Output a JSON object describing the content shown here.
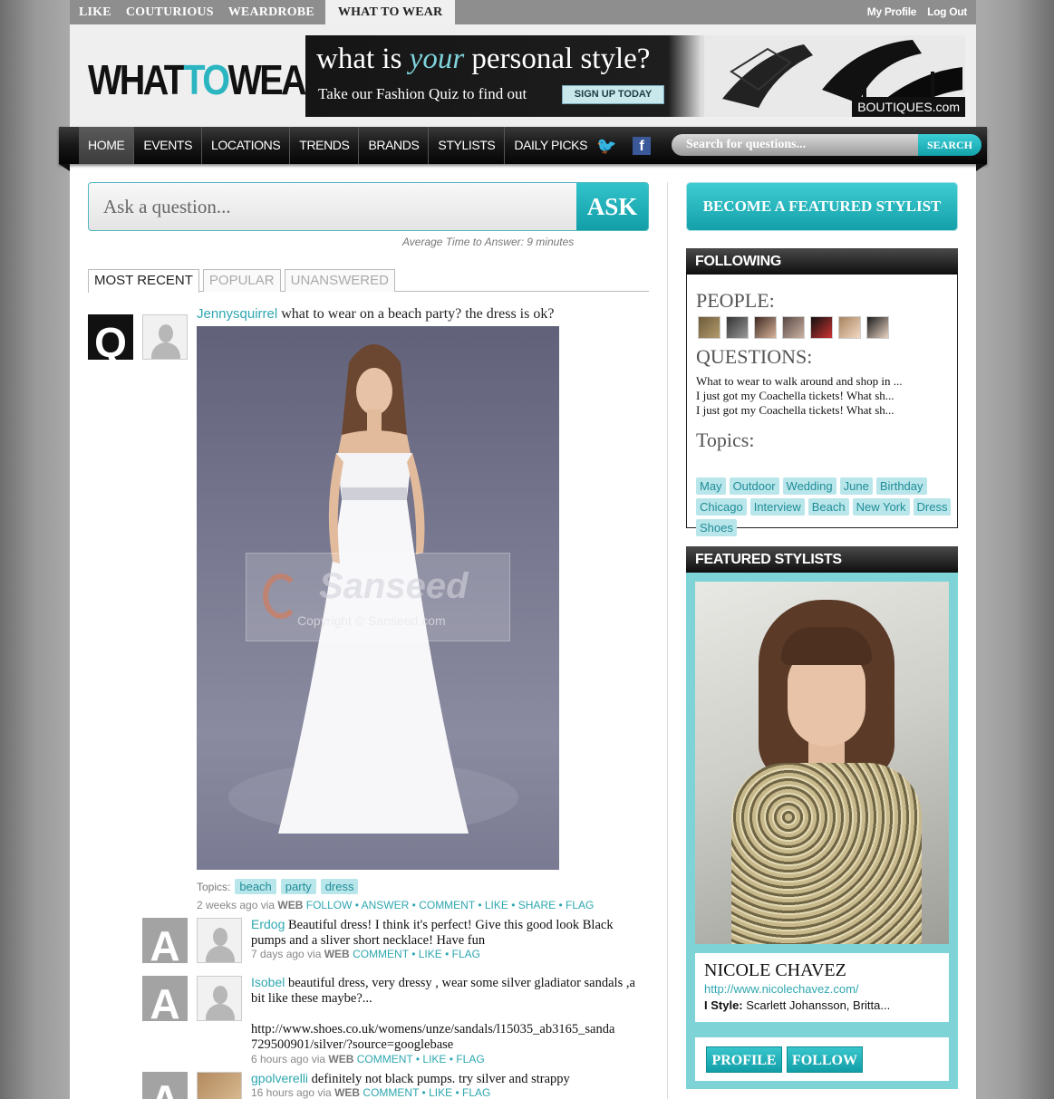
{
  "netbar": {
    "sites": [
      "LIKE",
      "COUTURIOUS",
      "WEARDROBE"
    ],
    "active_site": "WHAT TO WEAR",
    "my_profile": "My Profile",
    "log_out": "Log Out"
  },
  "logo": {
    "part1": "WHAT",
    "part2": "TO",
    "part3": "WEAR"
  },
  "banner": {
    "headline_pre": "what is ",
    "headline_em": "your",
    "headline_post": " personal style?",
    "sub": "Take our Fashion Quiz to find out",
    "cta": "SIGN UP TODAY",
    "brand": "BOUTIQUES.com"
  },
  "nav": {
    "items": [
      "HOME",
      "EVENTS",
      "LOCATIONS",
      "TRENDS",
      "BRANDS",
      "STYLISTS",
      "DAILY PICKS"
    ],
    "search_placeholder": "Search for questions...",
    "search_button": "SEARCH",
    "facebook_glyph": "f",
    "twitter_glyph": "🐦"
  },
  "ask": {
    "placeholder": "Ask a question...",
    "button": "ASK",
    "avg_time": "Average Time to Answer: 9 minutes"
  },
  "tabs": [
    "MOST RECENT",
    "POPULAR",
    "UNANSWERED"
  ],
  "question": {
    "icon_letter": "Q",
    "user": "Jennysquirrel",
    "text": " what to wear on a beach party? the dress is ok?",
    "watermark_brand": "Sanseed",
    "watermark_copy": "Copyright © Sanseed.com",
    "topics_label": "Topics:",
    "topics": [
      "beach",
      "party",
      "dress"
    ],
    "meta": {
      "time": "2 weeks ago via ",
      "source": "WEB",
      "actions": [
        "FOLLOW",
        "ANSWER",
        "COMMENT",
        "LIKE",
        "SHARE",
        "FLAG"
      ]
    }
  },
  "answers": [
    {
      "icon_letter": "A",
      "user": "Erdog",
      "text": " Beautiful dress! I think it's perfect! Give this good look Black pumps and a sliver short necklace! Have fun",
      "time": "7 days ago via ",
      "source": "WEB",
      "actions": [
        "COMMENT",
        "LIKE",
        "FLAG"
      ]
    },
    {
      "icon_letter": "A",
      "user": "Isobel",
      "text": " beautiful dress, very dressy , wear some silver gladiator sandals ,a bit like these maybe?...",
      "link_line1": "http://www.shoes.co.uk/womens/unze/sandals/l15035_ab3165_sanda",
      "link_line2": "729500901/silver/?source=googlebase",
      "time": "6 hours ago via ",
      "source": "WEB",
      "actions": [
        "COMMENT",
        "LIKE",
        "FLAG"
      ]
    },
    {
      "icon_letter": "A",
      "user": "gpolverelli",
      "text": " definitely not black pumps. try silver and strappy",
      "time": "16 hours ago via ",
      "source": "WEB",
      "actions": [
        "COMMENT",
        "LIKE",
        "FLAG"
      ]
    }
  ],
  "sidebar": {
    "become_button": "BECOME A FEATURED STYLIST",
    "following": {
      "title": "FOLLOWING",
      "people_label": "PEOPLE:",
      "questions_label": "QUESTIONS:",
      "questions": [
        "What to wear to walk around and shop in ...",
        "I just got my Coachella tickets! What sh...",
        "I just got my Coachella tickets! What sh..."
      ],
      "topics_label": "Topics:",
      "topics": [
        "May",
        "Outdoor",
        "Wedding",
        "June",
        "Birthday",
        "Chicago",
        "Interview",
        "Beach",
        "New York",
        "Dress",
        "Shoes"
      ]
    },
    "featured": {
      "title": "FEATURED STYLISTS",
      "name": "NICOLE CHAVEZ",
      "url": "http://www.nicolechavez.com/",
      "istyle_label": "I Style:",
      "istyle_value": " Scarlett Johansson, Britta...",
      "profile_button": "PROFILE",
      "follow_button": "FOLLOW"
    }
  },
  "colors": {
    "accent": "#2fa7b1",
    "accent_button": "#129ea7",
    "topic_bg": "#b9e6ea",
    "nav_bg": "#0e0e0e",
    "featured_bg": "#7ed3d6"
  }
}
